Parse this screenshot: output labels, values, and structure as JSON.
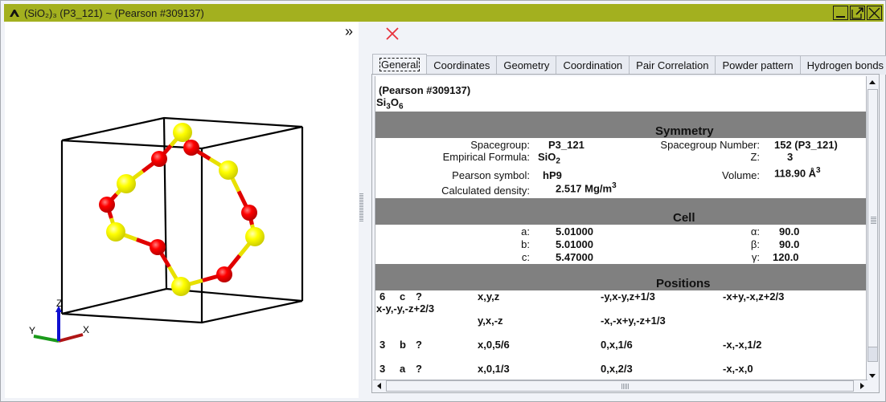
{
  "window": {
    "title": "(SiO₂)₃  (P3_121) ~  (Pearson #309137)",
    "app_icon": "crystal-logo-icon",
    "buttons": [
      "minimize-icon",
      "maximize-icon",
      "close-icon"
    ],
    "title_bar_color": "#a3b01f"
  },
  "viewer": {
    "axes": {
      "x": "X",
      "y": "Y",
      "z": "Z"
    },
    "atom_colors": {
      "Si": "#ffff00",
      "O": "#ff0000"
    },
    "unit_cell_color": "#000000"
  },
  "toolbar": {
    "collapse_glyph": "»",
    "close_icon_color": "#e8323c"
  },
  "tabs": [
    {
      "label": "General",
      "active": true
    },
    {
      "label": "Coordinates",
      "active": false
    },
    {
      "label": "Geometry",
      "active": false
    },
    {
      "label": "Coordination",
      "active": false
    },
    {
      "label": "Pair Correlation",
      "active": false
    },
    {
      "label": "Powder pattern",
      "active": false
    },
    {
      "label": "Hydrogen bonds",
      "active": false
    }
  ],
  "general": {
    "heading": "(Pearson #309137)",
    "formula": {
      "parts": [
        [
          "Si",
          "3"
        ],
        [
          "O",
          "6"
        ]
      ]
    },
    "symmetry": {
      "title": "Symmetry",
      "spacegroup_label": "Spacegroup:",
      "spacegroup_value": "P3_121",
      "empirical_label": "Empirical Formula:",
      "empirical_value_base": "SiO",
      "empirical_value_sub": "2",
      "pearson_label": "Pearson symbol:",
      "pearson_value": "hP9",
      "density_label": "Calculated density:",
      "density_value": "2.517 Mg/m",
      "density_sup": "3",
      "sgnum_label": "Spacegroup Number:",
      "sgnum_value": "152 (P3_121)",
      "z_label": "Z:",
      "z_value": "3",
      "volume_label": "Volume:",
      "volume_value": "118.90 Å",
      "volume_sup": "3"
    },
    "cell": {
      "title": "Cell",
      "a_label": "a:",
      "a_value": "5.01000",
      "b_label": "b:",
      "b_value": "5.01000",
      "c_label": "c:",
      "c_value": "5.47000",
      "alpha_label": "α:",
      "alpha_value": "90.0",
      "beta_label": "β:",
      "beta_value": "90.0",
      "gamma_label": "γ:",
      "gamma_value": "120.0"
    },
    "positions": {
      "title": "Positions",
      "rows": [
        {
          "mult": "6",
          "wyckoff": "c",
          "element": "?",
          "ops": [
            "x,y,z",
            "-y,x-y,z+1/3",
            "-x+y,-x,z+2/3"
          ],
          "wrap": "x-y,-y,-z+2/3",
          "ops2": [
            "y,x,-z",
            "-x,-x+y,-z+1/3"
          ]
        },
        {
          "mult": "3",
          "wyckoff": "b",
          "element": "?",
          "ops": [
            "x,0,5/6",
            "0,x,1/6",
            "-x,-x,1/2"
          ]
        },
        {
          "mult": "3",
          "wyckoff": "a",
          "element": "?",
          "ops": [
            "x,0,1/3",
            "0,x,2/3",
            "-x,-x,0"
          ]
        }
      ]
    }
  }
}
